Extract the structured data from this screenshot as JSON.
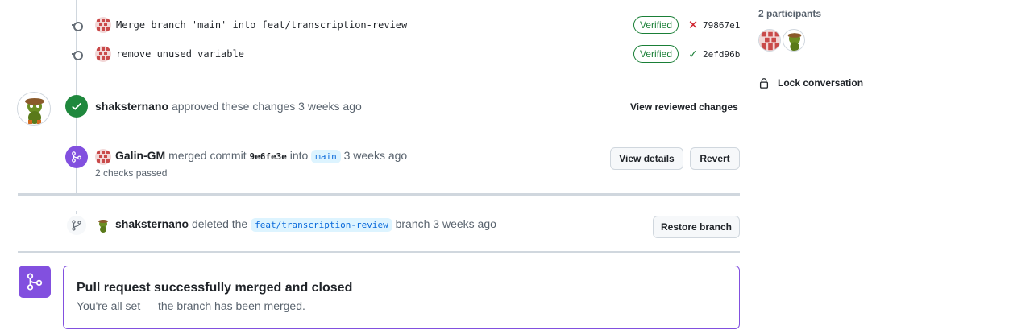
{
  "commits": [
    {
      "message": "Merge branch 'main' into feat/transcription-review",
      "verified": "Verified",
      "status": "failed",
      "sha": "79867e1"
    },
    {
      "message": "remove unused variable",
      "verified": "Verified",
      "status": "passed",
      "sha": "2efd96b"
    }
  ],
  "approval": {
    "user": "shaksternano",
    "text": "approved these changes",
    "time": "3 weeks ago",
    "action": "View reviewed changes"
  },
  "merge": {
    "user": "Galin-GM",
    "text1": "merged commit",
    "commit": "9e6fe3e",
    "text2": "into",
    "branch": "main",
    "time": "3 weeks ago",
    "checks": "2 checks passed",
    "details_btn": "View details",
    "revert_btn": "Revert"
  },
  "deleted": {
    "user": "shaksternano",
    "text1": "deleted the",
    "branch": "feat/transcription-review",
    "text2": "branch",
    "time": "3 weeks ago",
    "restore_btn": "Restore branch"
  },
  "merged_box": {
    "title": "Pull request successfully merged and closed",
    "subtitle": "You're all set — the branch has been merged."
  },
  "sidebar": {
    "participants_label": "2 participants",
    "lock_label": "Lock conversation"
  },
  "colors": {
    "green": "#1f883d",
    "purple": "#8250df",
    "red": "#cf222e",
    "blue_tag": "#ddf4ff"
  }
}
